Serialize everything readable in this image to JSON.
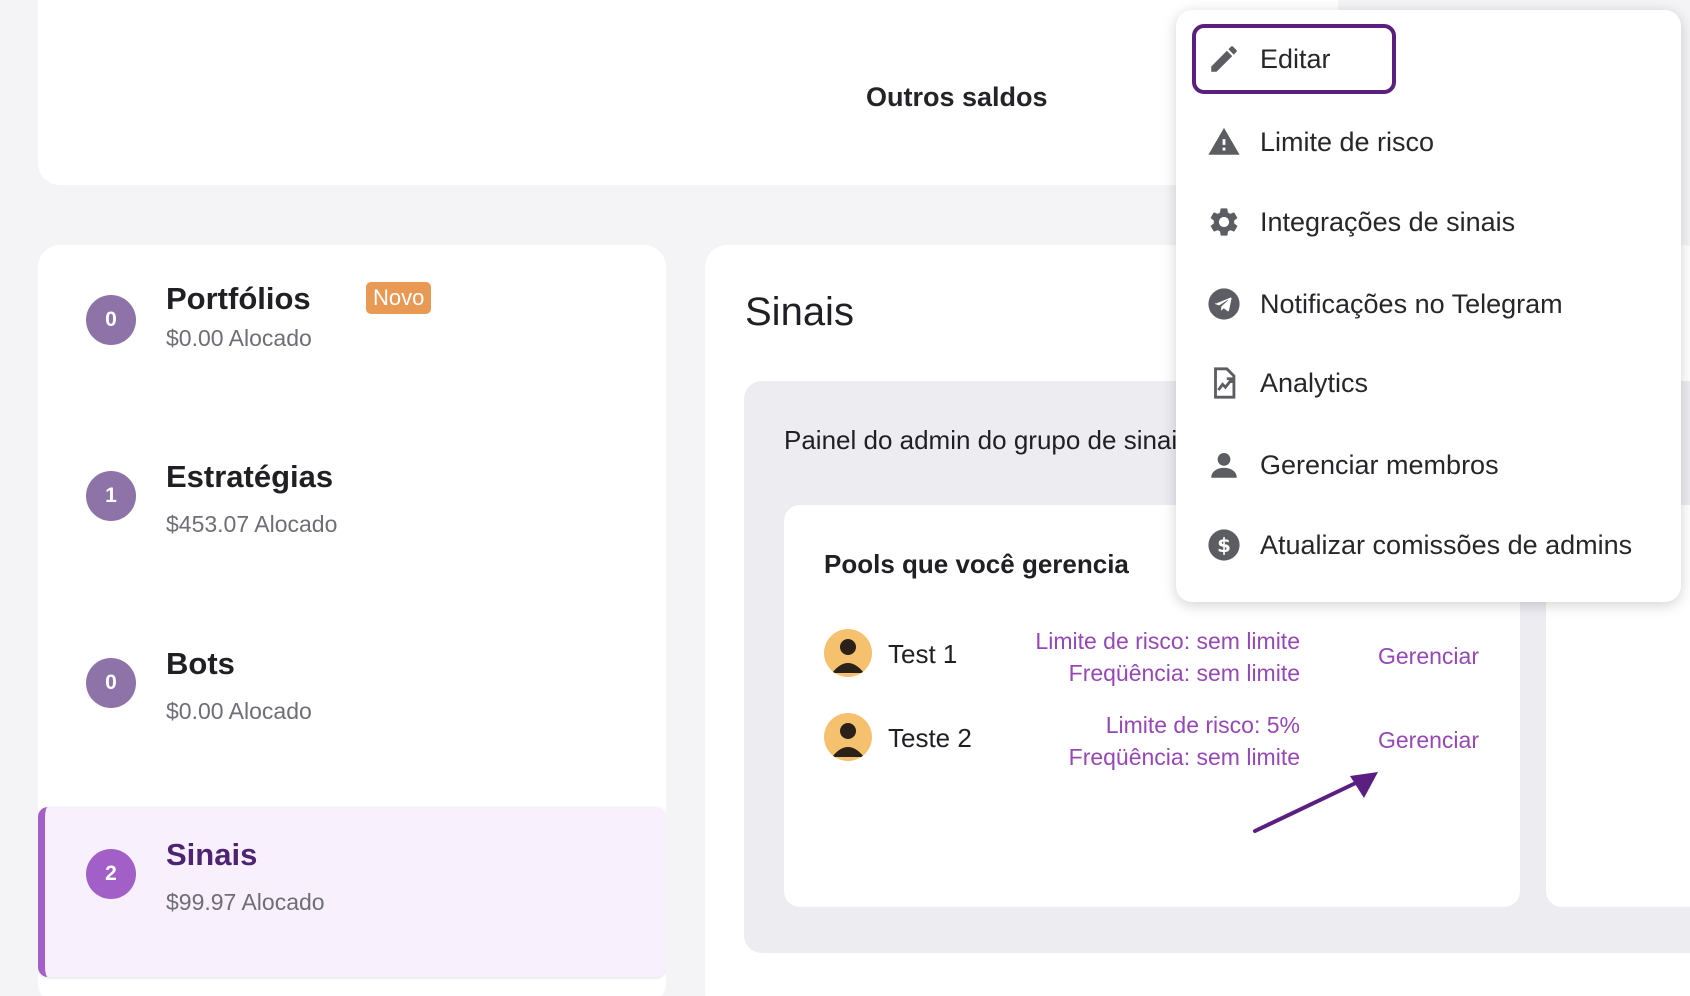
{
  "top": {
    "balance_title": "Outros saldos"
  },
  "sidebar": {
    "items": [
      {
        "count": "0",
        "name": "Portfólios",
        "badge": "Novo",
        "alloc": "$0.00 Alocado"
      },
      {
        "count": "1",
        "name": "Estratégias",
        "alloc": "$453.07 Alocado"
      },
      {
        "count": "0",
        "name": "Bots",
        "alloc": "$0.00 Alocado"
      },
      {
        "count": "2",
        "name": "Sinais",
        "alloc": "$99.97 Alocado",
        "active": true
      }
    ]
  },
  "main": {
    "title": "Sinais",
    "panel_caption": "Painel do admin do grupo de sinais",
    "pools_title": "Pools que você gerencia",
    "pools": [
      {
        "name": "Test 1",
        "risk": "Limite de risco: sem limite",
        "freq": "Freqüência: sem limite",
        "action": "Gerenciar"
      },
      {
        "name": "Teste 2",
        "risk": "Limite de risco: 5%",
        "freq": "Freqüência: sem limite",
        "action": "Gerenciar"
      }
    ]
  },
  "menu": {
    "items": [
      {
        "label": "Editar",
        "icon": "pencil-icon",
        "selected": true
      },
      {
        "label": "Limite de risco",
        "icon": "warning-icon"
      },
      {
        "label": "Integrações de sinais",
        "icon": "gear-icon"
      },
      {
        "label": "Notificações no Telegram",
        "icon": "telegram-icon"
      },
      {
        "label": "Analytics",
        "icon": "analytics-icon"
      },
      {
        "label": "Gerenciar membros",
        "icon": "person-icon"
      },
      {
        "label": "Atualizar comissões de admins",
        "icon": "dollar-icon"
      }
    ]
  },
  "colors": {
    "accent": "#9648b4",
    "active_border": "#a25fc8",
    "menu_focus": "#5b1f7d",
    "badge": "#e89a55",
    "avatar": "#f6c16e"
  }
}
